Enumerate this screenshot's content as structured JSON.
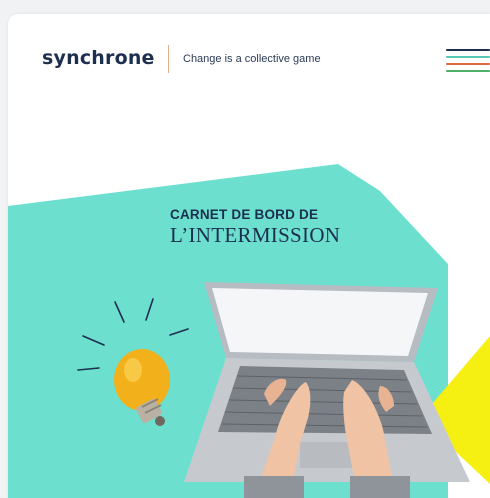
{
  "header": {
    "logo_text": "synchrone",
    "tagline": "Change is a collective game",
    "menu_icon": "hamburger-menu-icon"
  },
  "hero": {
    "title_line1": "CARNET DE BORD DE",
    "title_line2": "L’INTERMISSION",
    "image": "laptop-typing-lightbulb-illustration"
  },
  "colors": {
    "brand_navy": "#1d2f4f",
    "turquoise": "#6ddfcf",
    "yellow": "#f6ef12",
    "menu_line_1": "#1d2f4f",
    "menu_line_2": "#57c7b5",
    "menu_line_3": "#e0673e",
    "menu_line_4": "#4caf6a"
  }
}
